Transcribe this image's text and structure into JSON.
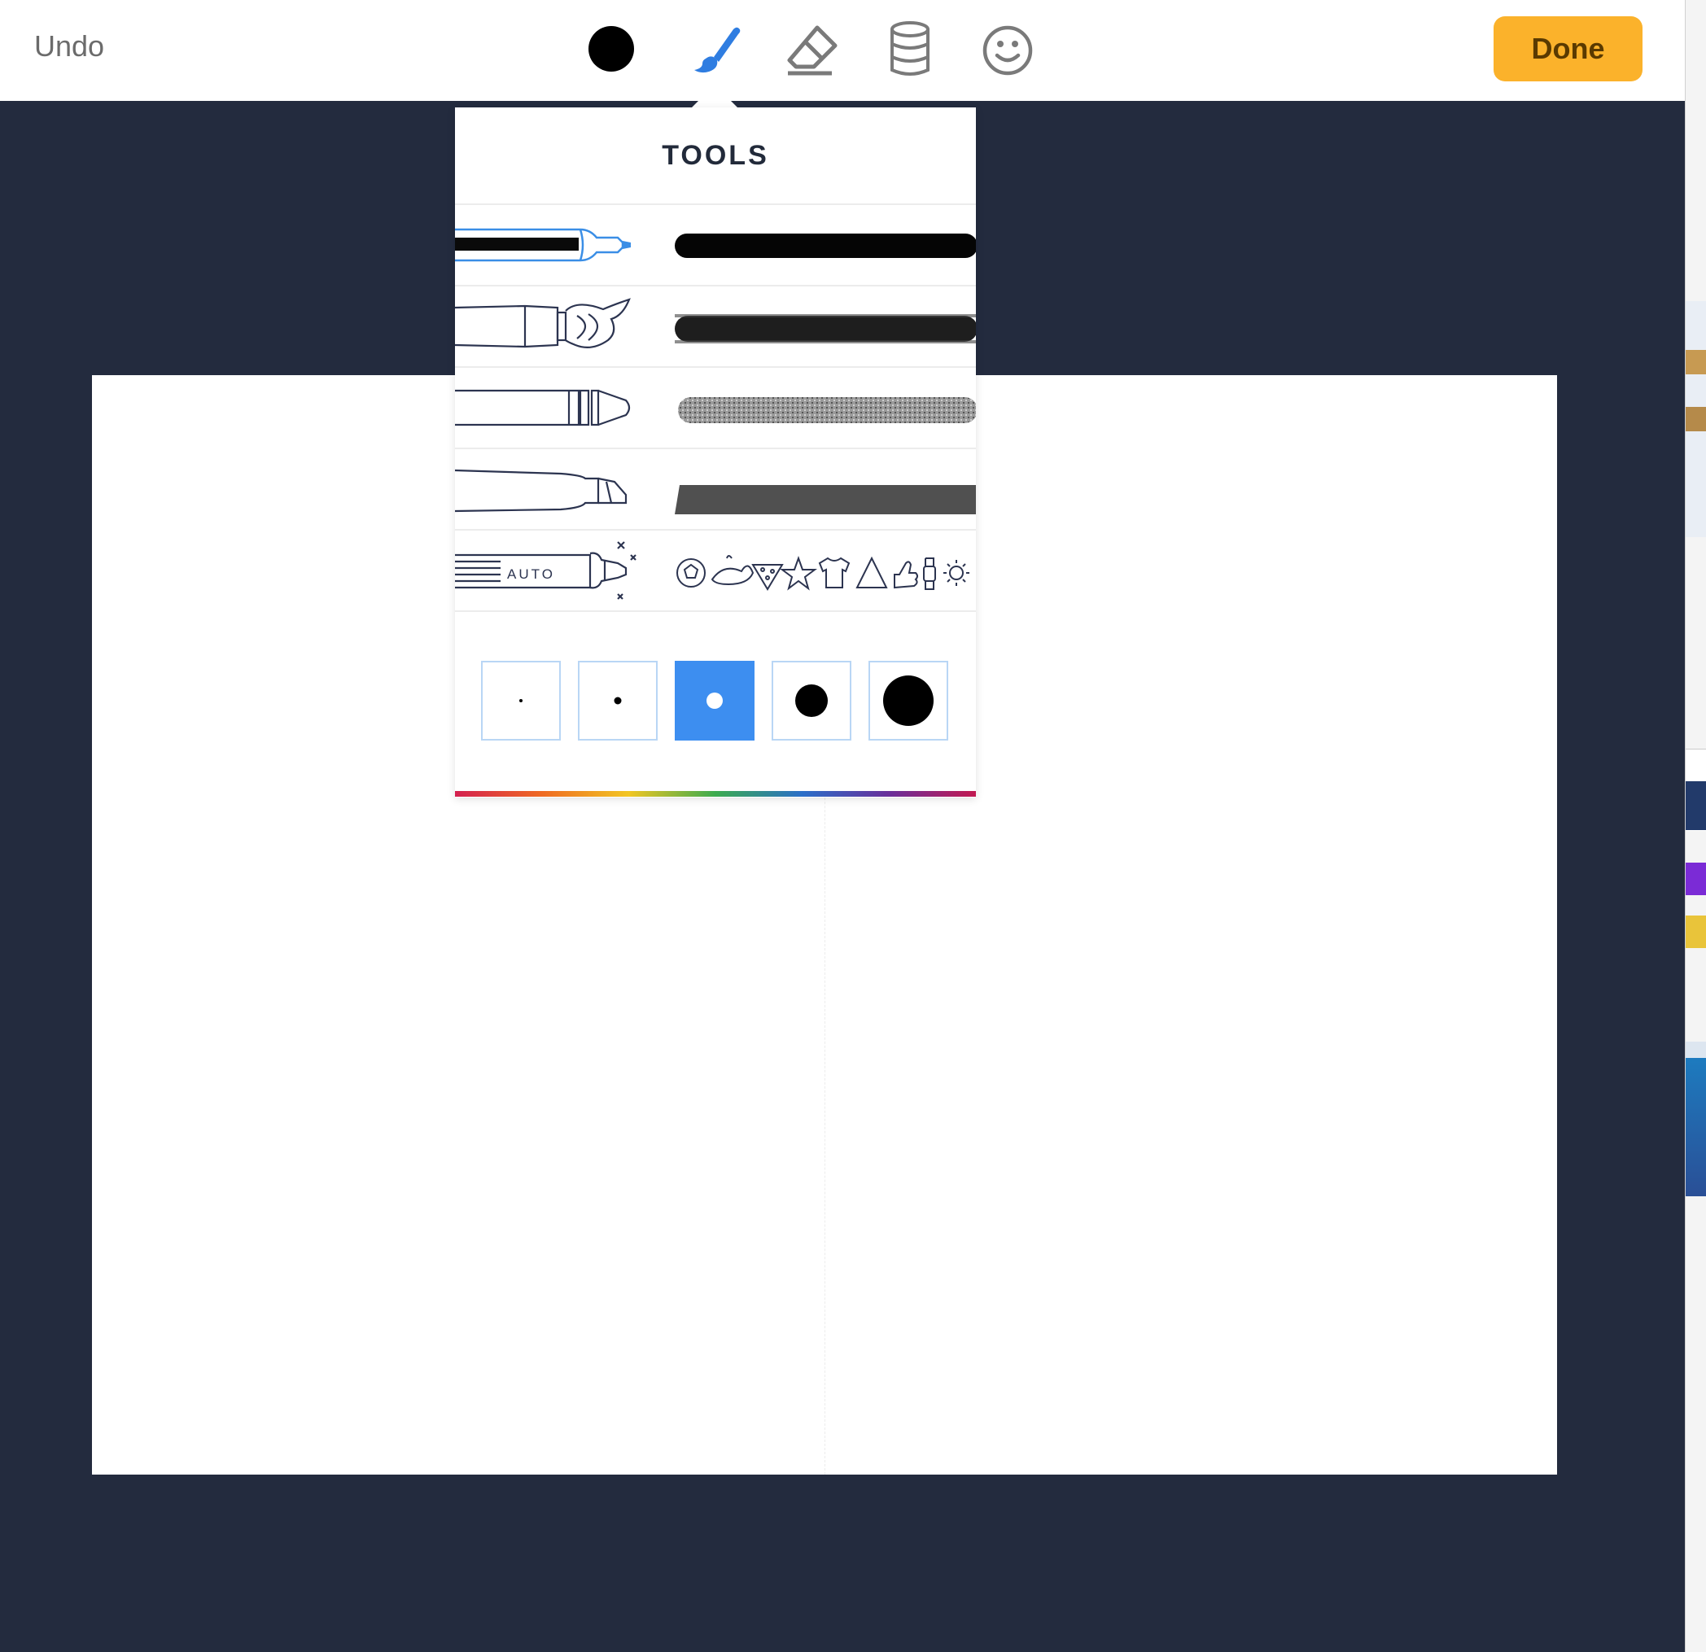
{
  "toolbar": {
    "undo_label": "Undo",
    "done_label": "Done",
    "tools": [
      {
        "name": "color-picker",
        "icon": "black-circle-icon",
        "color": "#000000"
      },
      {
        "name": "brush",
        "icon": "paintbrush-icon",
        "active": true,
        "color": "#2f7de1"
      },
      {
        "name": "eraser",
        "icon": "eraser-icon"
      },
      {
        "name": "fill",
        "icon": "paint-bucket-icon"
      },
      {
        "name": "stickers",
        "icon": "smiley-icon"
      }
    ]
  },
  "tools_panel": {
    "title": "TOOLS",
    "brushes": [
      {
        "name": "marker",
        "icon": "marker-pen-icon",
        "selected": true
      },
      {
        "name": "paintbrush",
        "icon": "paintbrush-tool-icon"
      },
      {
        "name": "crayon",
        "icon": "crayon-icon"
      },
      {
        "name": "highlighter",
        "icon": "highlighter-icon"
      },
      {
        "name": "auto",
        "icon": "auto-draw-pen-icon",
        "label": "AUTO",
        "preview_icons": [
          "soccer-ball",
          "whale",
          "pizza-slice",
          "star",
          "t-shirt",
          "triangle",
          "thumbs-up",
          "watch",
          "sun"
        ]
      }
    ],
    "sizes": [
      {
        "name": "size-xs",
        "selected": false
      },
      {
        "name": "size-s",
        "selected": false
      },
      {
        "name": "size-m",
        "selected": true
      },
      {
        "name": "size-l",
        "selected": false
      },
      {
        "name": "size-xl",
        "selected": false
      }
    ]
  },
  "colors": {
    "background": "#232b3e",
    "accent": "#3d8ef0",
    "done_button": "#fbb22b",
    "panel_title": "#222a3a"
  }
}
